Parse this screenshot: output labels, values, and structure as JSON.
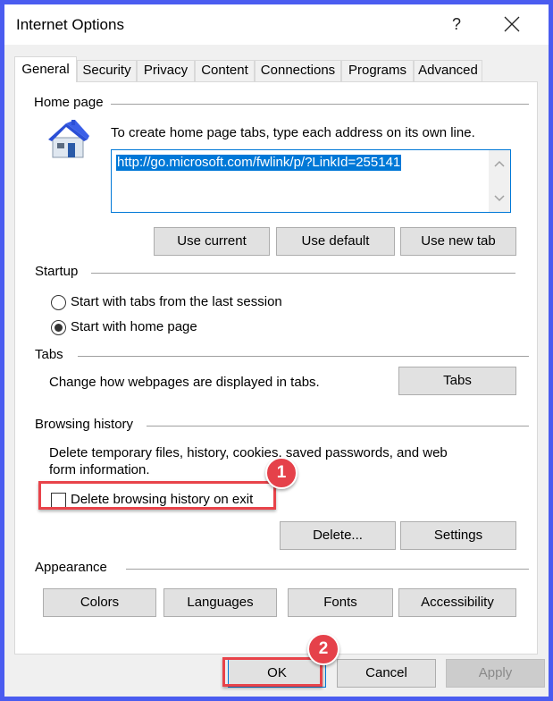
{
  "window": {
    "title": "Internet Options",
    "help_label": "?",
    "close_icon": "close-icon"
  },
  "tabs": [
    {
      "label": "General",
      "active": true
    },
    {
      "label": "Security",
      "active": false
    },
    {
      "label": "Privacy",
      "active": false
    },
    {
      "label": "Content",
      "active": false
    },
    {
      "label": "Connections",
      "active": false
    },
    {
      "label": "Programs",
      "active": false
    },
    {
      "label": "Advanced",
      "active": false
    }
  ],
  "home_page": {
    "group_label": "Home page",
    "icon": "house-icon",
    "instruction": "To create home page tabs, type each address on its own line.",
    "url_value": "http://go.microsoft.com/fwlink/p/?LinkId=255141",
    "buttons": {
      "use_current": "Use current",
      "use_default": "Use default",
      "use_new_tab": "Use new tab"
    }
  },
  "startup": {
    "group_label": "Startup",
    "options": [
      {
        "label": "Start with tabs from the last session",
        "selected": false
      },
      {
        "label": "Start with home page",
        "selected": true
      }
    ]
  },
  "tabs_section": {
    "group_label": "Tabs",
    "description": "Change how webpages are displayed in tabs.",
    "button": "Tabs"
  },
  "browsing_history": {
    "group_label": "Browsing history",
    "description_line1": "Delete temporary files, history, cookies, saved passwords, and web",
    "description_line2": "form information.",
    "checkbox_label": "Delete browsing history on exit",
    "checkbox_checked": false,
    "buttons": {
      "delete": "Delete...",
      "settings": "Settings"
    }
  },
  "appearance": {
    "group_label": "Appearance",
    "buttons": {
      "colors": "Colors",
      "languages": "Languages",
      "fonts": "Fonts",
      "accessibility": "Accessibility"
    }
  },
  "footer": {
    "ok": "OK",
    "cancel": "Cancel",
    "apply": "Apply",
    "apply_enabled": false
  },
  "annotations": {
    "step1": "1",
    "step2": "2",
    "highlight_color": "#e8434a"
  }
}
